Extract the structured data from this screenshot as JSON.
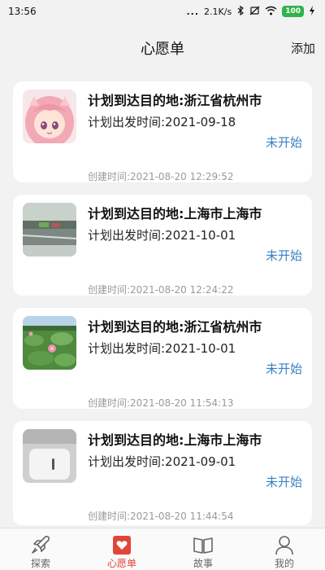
{
  "status_bar": {
    "time": "13:56",
    "signal_dots": "...",
    "network_speed": "2.1K/s",
    "battery": "100"
  },
  "header": {
    "title": "心愿单",
    "add_label": "添加"
  },
  "wishlist": [
    {
      "destination": "计划到达目的地:浙江省杭州市",
      "departure": "计划出发时间:2021-09-18",
      "created": "创建时间:2021-08-20 12:29:52",
      "status": "未开始",
      "thumb_icon": "anime-avatar-thumbnail"
    },
    {
      "destination": "计划到达目的地:上海市上海市",
      "departure": "计划出发时间:2021-10-01",
      "created": "创建时间:2021-08-20 12:24:22",
      "status": "未开始",
      "thumb_icon": "street-photo-thumbnail"
    },
    {
      "destination": "计划到达目的地:浙江省杭州市",
      "departure": "计划出发时间:2021-10-01",
      "created": "创建时间:2021-08-20 11:54:13",
      "status": "未开始",
      "thumb_icon": "lotus-photo-thumbnail"
    },
    {
      "destination": "计划到达目的地:上海市上海市",
      "departure": "计划出发时间:2021-09-01",
      "created": "创建时间:2021-08-20 11:44:54",
      "status": "未开始",
      "thumb_icon": "device-photo-thumbnail"
    }
  ],
  "bottom_nav": [
    {
      "label": "探索",
      "icon": "rocket-icon",
      "active": false
    },
    {
      "label": "心愿单",
      "icon": "heart-list-icon",
      "active": true
    },
    {
      "label": "故事",
      "icon": "book-icon",
      "active": false
    },
    {
      "label": "我的",
      "icon": "user-icon",
      "active": false
    }
  ],
  "colors": {
    "accent": "#e0453a",
    "status_text": "#3a7fc4",
    "battery": "#2fb44b"
  }
}
